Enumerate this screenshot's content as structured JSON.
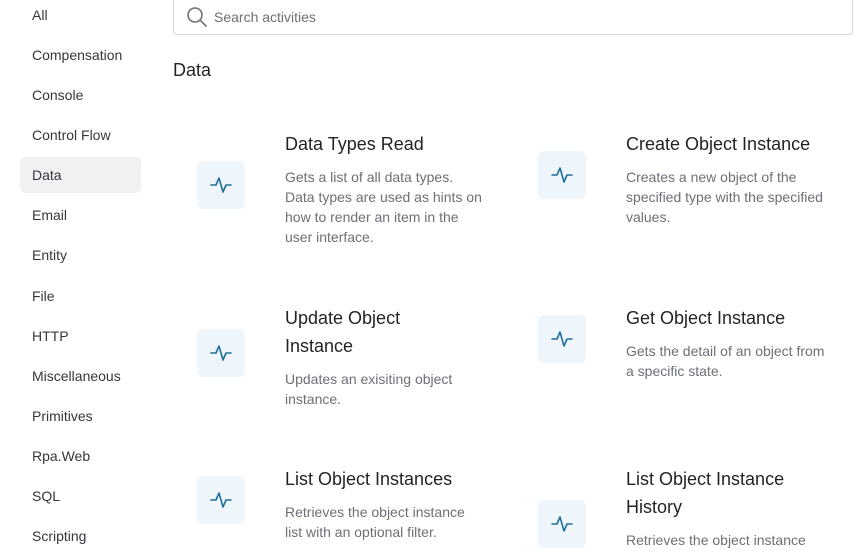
{
  "sidebar": {
    "items": [
      {
        "label": "All"
      },
      {
        "label": "Compensation"
      },
      {
        "label": "Console"
      },
      {
        "label": "Control Flow"
      },
      {
        "label": "Data",
        "active": true
      },
      {
        "label": "Email"
      },
      {
        "label": "Entity"
      },
      {
        "label": "File"
      },
      {
        "label": "HTTP"
      },
      {
        "label": "Miscellaneous"
      },
      {
        "label": "Primitives"
      },
      {
        "label": "Rpa.Web"
      },
      {
        "label": "SQL"
      },
      {
        "label": "Scripting"
      }
    ]
  },
  "search": {
    "placeholder": "Search activities",
    "icon": "search-icon"
  },
  "section": {
    "title": "Data"
  },
  "activities": [
    {
      "title": "Data Types Read",
      "description": "Gets a list of all data types. Data types are used as hints on how to render an item in the user interface.",
      "icon": "pulse-icon"
    },
    {
      "title": "Create Object Instance",
      "description": "Creates a new object of the specified type with the specified values.",
      "icon": "pulse-icon"
    },
    {
      "title": "Update Object Instance",
      "description": "Updates an exisiting object instance.",
      "icon": "pulse-icon"
    },
    {
      "title": "Get Object Instance",
      "description": "Gets the detail of an object from a specific state.",
      "icon": "pulse-icon"
    },
    {
      "title": "List Object Instances",
      "description": "Retrieves the object instance list with an optional filter.",
      "icon": "pulse-icon"
    },
    {
      "title": "List Object Instance History",
      "description": "Retrieves the object instance",
      "icon": "pulse-icon"
    }
  ],
  "colors": {
    "accent": "#1f6f9c",
    "icon_bg": "#eef6fc",
    "active_bg": "#f0f1f3"
  }
}
